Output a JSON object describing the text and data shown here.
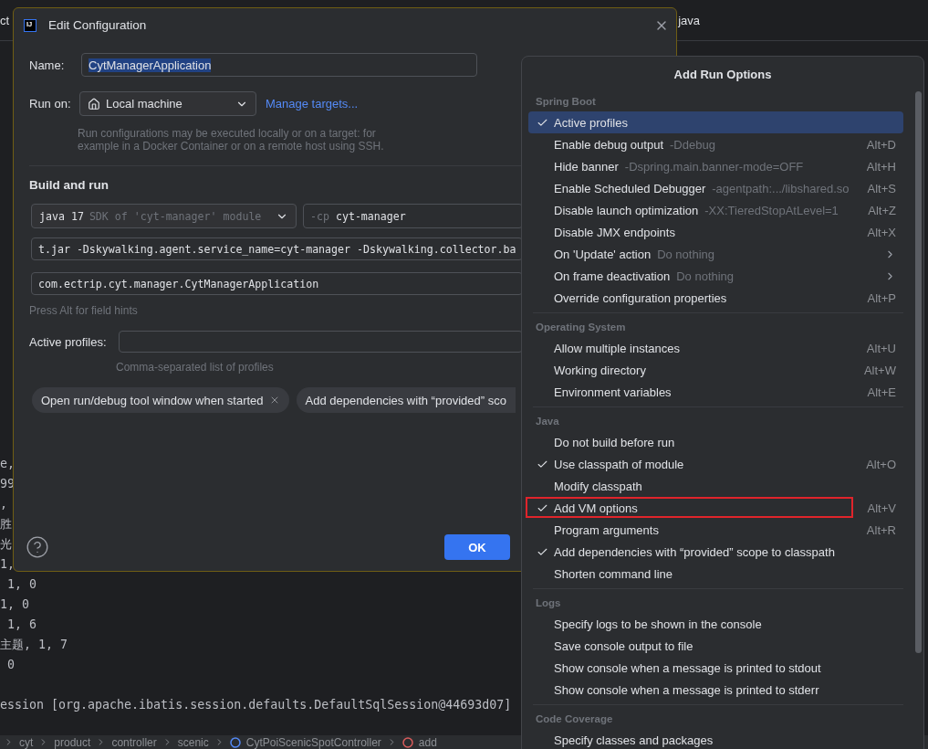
{
  "editor_tabs": [
    "ct",
    "java"
  ],
  "console": {
    "lines": [
      "e,",
      "99",
      ",",
      "胜",
      "光",
      "1,",
      " 1, 0",
      "1, 0",
      " 1, 6",
      "主题, 1, 7",
      " 0"
    ],
    "last_line": "ession [org.apache.ibatis.session.defaults.DefaultSqlSession@44693d07]"
  },
  "breadcrumb": [
    {
      "label": "cyt",
      "kind": "folder"
    },
    {
      "label": "product",
      "kind": "folder"
    },
    {
      "label": "controller",
      "kind": "folder"
    },
    {
      "label": "scenic",
      "kind": "folder"
    },
    {
      "label": "CytPoiScenicSpotController",
      "kind": "class"
    },
    {
      "label": "add",
      "kind": "method"
    }
  ],
  "dialog": {
    "logo_text": "IJ",
    "title": "Edit Configuration",
    "name": {
      "label": "Name:",
      "value": "CytManagerApplication",
      "value_selected": true
    },
    "run_on": {
      "label": "Run on:",
      "value": "Local machine",
      "link": "Manage targets...",
      "hint": "Run configurations may be executed locally or on a target: for example in a Docker Container or on a remote host using SSH."
    },
    "section": "Build and run",
    "jdk": {
      "value": "java 17",
      "hint": "SDK of 'cyt-manager' module"
    },
    "classpath": {
      "prefix": "-cp",
      "value": "cyt-manager"
    },
    "vm_options": "t.jar -Dskywalking.agent.service_name=cyt-manager -Dskywalking.collector.ba",
    "main_class": "com.ectrip.cyt.manager.CytManagerApplication",
    "field_hint": "Press Alt for field hints",
    "active_profiles": {
      "label": "Active profiles:",
      "hint": "Comma-separated list of profiles"
    },
    "chips": [
      {
        "label": "Open run/debug tool window when started",
        "removable": true
      },
      {
        "label": "Add dependencies with “provided” sco",
        "removable": false
      }
    ],
    "ok_button": "OK"
  },
  "popup": {
    "title": "Add Run Options",
    "sections": [
      {
        "header": "Spring Boot",
        "items": [
          {
            "label": "Active profiles",
            "checked": true,
            "selected": true,
            "submenu": false,
            "outlined": false
          },
          {
            "label": "Enable debug output",
            "hint": "-Ddebug",
            "shortcut": "Alt+D",
            "checked": false,
            "selected": false,
            "submenu": false,
            "outlined": false
          },
          {
            "label": "Hide banner",
            "hint": "-Dspring.main.banner-mode=OFF",
            "shortcut": "Alt+H",
            "checked": false,
            "selected": false,
            "submenu": false,
            "outlined": false
          },
          {
            "label": "Enable Scheduled Debugger",
            "hint": "-agentpath:.../libshared.so",
            "shortcut": "Alt+S",
            "checked": false,
            "selected": false,
            "submenu": false,
            "outlined": false
          },
          {
            "label": "Disable launch optimization",
            "hint": "-XX:TieredStopAtLevel=1",
            "shortcut": "Alt+Z",
            "checked": false,
            "selected": false,
            "submenu": false,
            "outlined": false
          },
          {
            "label": "Disable JMX endpoints",
            "shortcut": "Alt+X",
            "checked": false,
            "selected": false,
            "submenu": false,
            "outlined": false
          },
          {
            "label": "On 'Update' action",
            "hint": "Do nothing",
            "checked": false,
            "selected": false,
            "submenu": true,
            "outlined": false
          },
          {
            "label": "On frame deactivation",
            "hint": "Do nothing",
            "checked": false,
            "selected": false,
            "submenu": true,
            "outlined": false
          },
          {
            "label": "Override configuration properties",
            "shortcut": "Alt+P",
            "checked": false,
            "selected": false,
            "submenu": false,
            "outlined": false
          }
        ]
      },
      {
        "header": "Operating System",
        "items": [
          {
            "label": "Allow multiple instances",
            "shortcut": "Alt+U",
            "checked": false,
            "selected": false,
            "submenu": false,
            "outlined": false
          },
          {
            "label": "Working directory",
            "shortcut": "Alt+W",
            "checked": false,
            "selected": false,
            "submenu": false,
            "outlined": false
          },
          {
            "label": "Environment variables",
            "shortcut": "Alt+E",
            "checked": false,
            "selected": false,
            "submenu": false,
            "outlined": false
          }
        ]
      },
      {
        "header": "Java",
        "items": [
          {
            "label": "Do not build before run",
            "checked": false,
            "selected": false,
            "submenu": false,
            "outlined": false
          },
          {
            "label": "Use classpath of module",
            "shortcut": "Alt+O",
            "checked": true,
            "selected": false,
            "submenu": false,
            "outlined": false
          },
          {
            "label": "Modify classpath",
            "checked": false,
            "selected": false,
            "submenu": false,
            "outlined": false
          },
          {
            "label": "Add VM options",
            "shortcut": "Alt+V",
            "checked": true,
            "selected": false,
            "submenu": false,
            "outlined": true
          },
          {
            "label": "Program arguments",
            "shortcut": "Alt+R",
            "checked": false,
            "selected": false,
            "submenu": false,
            "outlined": false
          },
          {
            "label": "Add dependencies with “provided” scope to classpath",
            "checked": true,
            "selected": false,
            "submenu": false,
            "outlined": false
          },
          {
            "label": "Shorten command line",
            "checked": false,
            "selected": false,
            "submenu": false,
            "outlined": false
          }
        ]
      },
      {
        "header": "Logs",
        "items": [
          {
            "label": "Specify logs to be shown in the console",
            "checked": false,
            "selected": false,
            "submenu": false,
            "outlined": false
          },
          {
            "label": "Save console output to file",
            "checked": false,
            "selected": false,
            "submenu": false,
            "outlined": false
          },
          {
            "label": "Show console when a message is printed to stdout",
            "checked": false,
            "selected": false,
            "submenu": false,
            "outlined": false
          },
          {
            "label": "Show console when a message is printed to stderr",
            "checked": false,
            "selected": false,
            "submenu": false,
            "outlined": false
          }
        ]
      },
      {
        "header": "Code Coverage",
        "items": [
          {
            "label": "Specify classes and packages",
            "checked": false,
            "selected": false,
            "submenu": false,
            "outlined": false
          }
        ]
      }
    ]
  }
}
